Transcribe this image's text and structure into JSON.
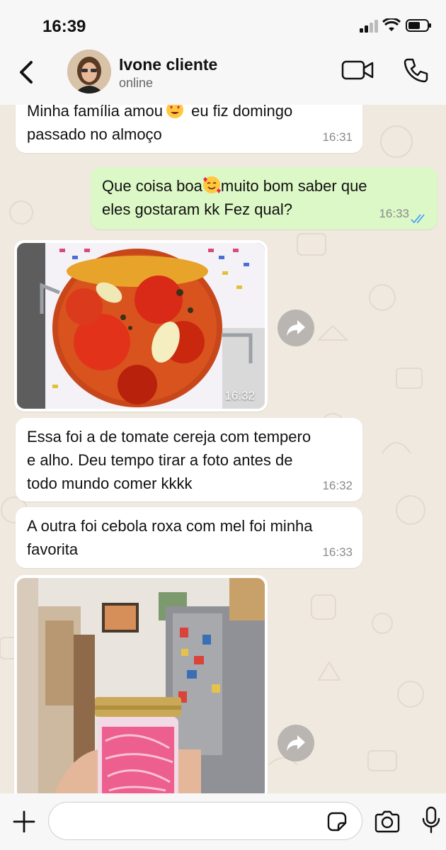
{
  "status_bar": {
    "time": "16:39"
  },
  "header": {
    "contact_name": "Ivone cliente",
    "contact_status": "online"
  },
  "messages": [
    {
      "direction": "in",
      "text_before": "Minha família amou",
      "emoji": "heart-eyes",
      "text_after": " eu fiz domingo\npassado no almoço",
      "time": "16:31"
    },
    {
      "direction": "out",
      "text_before": "Que coisa boa",
      "emoji": "smiling-hearts",
      "text_after": "muito bom saber que\neles gostaram kk Fez qual?",
      "time": "16:33",
      "read": true
    },
    {
      "direction": "in",
      "type": "image",
      "image_desc": "jar-of-cherry-tomatoes",
      "time": "16:32"
    },
    {
      "direction": "in",
      "text": "Essa foi a de tomate cereja com tempero\ne alho. Deu tempo tirar a foto antes de\ntodo mundo comer kkkk",
      "time": "16:32"
    },
    {
      "direction": "in",
      "text": "A outra foi cebola roxa com mel foi minha\nfavorita",
      "time": "16:33"
    },
    {
      "direction": "in",
      "type": "image",
      "image_desc": "jar-of-pickled-red-onion"
    }
  ],
  "colors": {
    "incoming": "#ffffff",
    "outgoing": "#dcf8c6",
    "read_ticks": "#4fa3f7",
    "wallpaper": "#efe9df"
  }
}
